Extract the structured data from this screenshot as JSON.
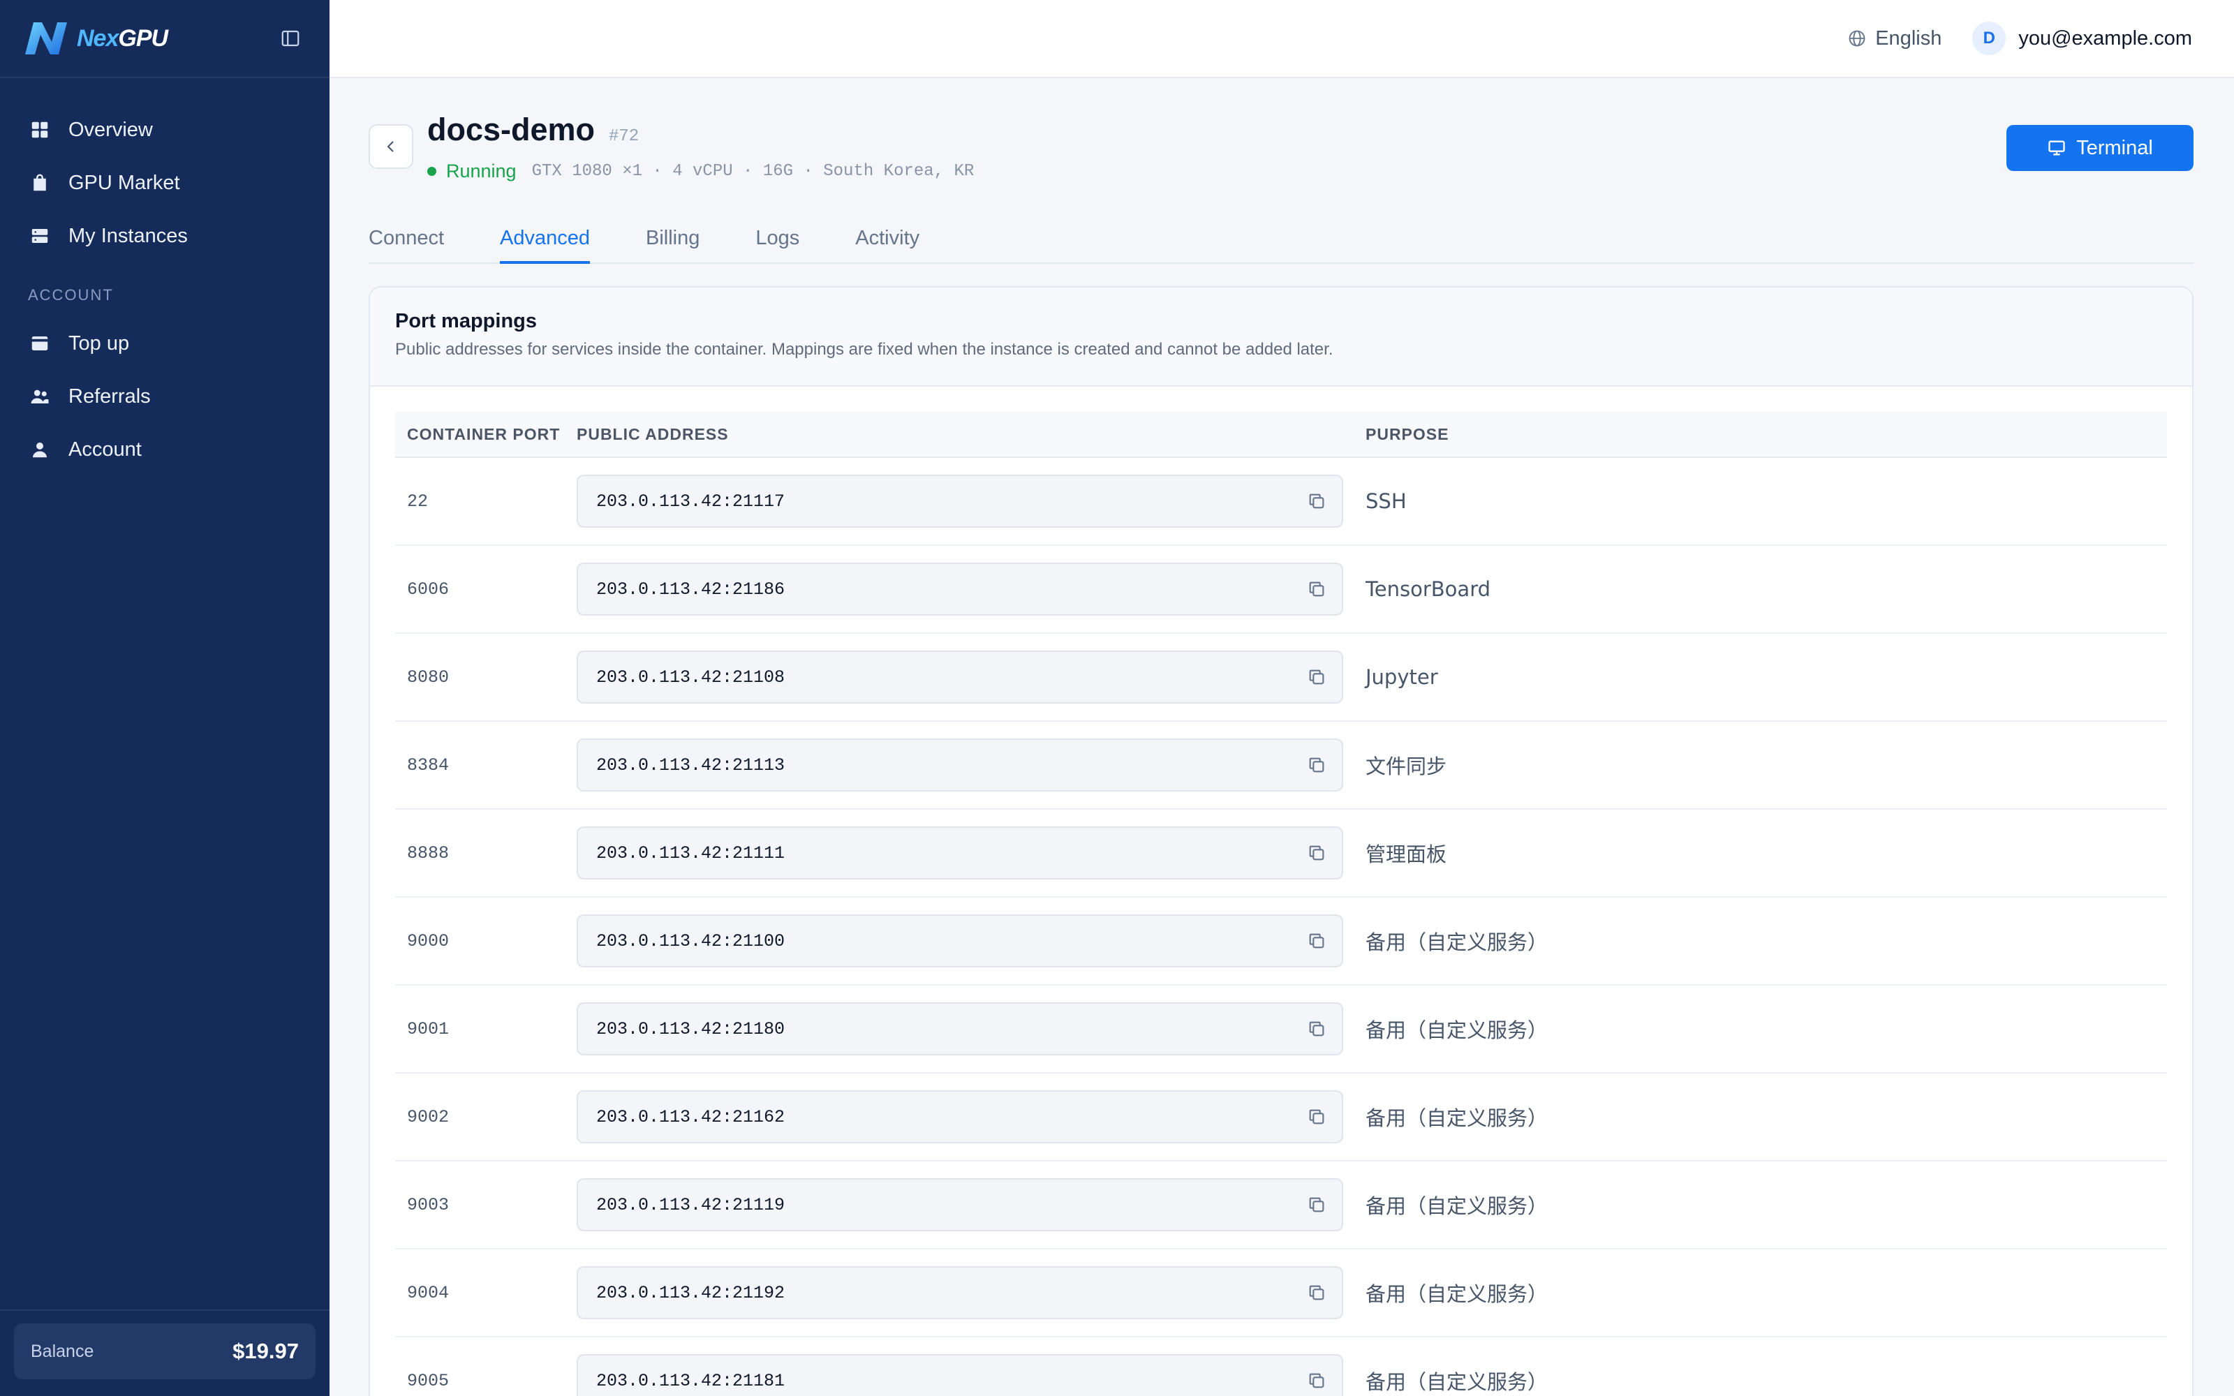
{
  "brand": {
    "name_part1": "Nex",
    "name_part2": "GPU"
  },
  "sidebar": {
    "items": [
      {
        "label": "Overview",
        "icon": "grid-icon"
      },
      {
        "label": "GPU Market",
        "icon": "bag-icon"
      },
      {
        "label": "My Instances",
        "icon": "server-icon"
      }
    ],
    "section_label": "ACCOUNT",
    "account_items": [
      {
        "label": "Top up",
        "icon": "card-icon"
      },
      {
        "label": "Referrals",
        "icon": "users-icon"
      },
      {
        "label": "Account",
        "icon": "user-icon"
      }
    ],
    "balance_label": "Balance",
    "balance_value": "$19.97"
  },
  "topbar": {
    "language": "English",
    "avatar_initial": "D",
    "email": "you@example.com"
  },
  "instance": {
    "name": "docs-demo",
    "id": "#72",
    "status": "Running",
    "specs": "GTX 1080 ×1 · 4 vCPU · 16G · South Korea, KR",
    "terminal_label": "Terminal"
  },
  "tabs": [
    {
      "label": "Connect",
      "active": false
    },
    {
      "label": "Advanced",
      "active": true
    },
    {
      "label": "Billing",
      "active": false
    },
    {
      "label": "Logs",
      "active": false
    },
    {
      "label": "Activity",
      "active": false
    }
  ],
  "ports_card": {
    "title": "Port mappings",
    "subtitle": "Public addresses for services inside the container. Mappings are fixed when the instance is created and cannot be added later.",
    "columns": [
      "CONTAINER PORT",
      "PUBLIC ADDRESS",
      "PURPOSE"
    ],
    "rows": [
      {
        "port": "22",
        "address": "203.0.113.42:21117",
        "purpose": "SSH"
      },
      {
        "port": "6006",
        "address": "203.0.113.42:21186",
        "purpose": "TensorBoard"
      },
      {
        "port": "8080",
        "address": "203.0.113.42:21108",
        "purpose": "Jupyter"
      },
      {
        "port": "8384",
        "address": "203.0.113.42:21113",
        "purpose": "文件同步"
      },
      {
        "port": "8888",
        "address": "203.0.113.42:21111",
        "purpose": "管理面板"
      },
      {
        "port": "9000",
        "address": "203.0.113.42:21100",
        "purpose": "备用（自定义服务）"
      },
      {
        "port": "9001",
        "address": "203.0.113.42:21180",
        "purpose": "备用（自定义服务）"
      },
      {
        "port": "9002",
        "address": "203.0.113.42:21162",
        "purpose": "备用（自定义服务）"
      },
      {
        "port": "9003",
        "address": "203.0.113.42:21119",
        "purpose": "备用（自定义服务）"
      },
      {
        "port": "9004",
        "address": "203.0.113.42:21192",
        "purpose": "备用（自定义服务）"
      },
      {
        "port": "9005",
        "address": "203.0.113.42:21181",
        "purpose": "备用（自定义服务）"
      }
    ]
  },
  "colors": {
    "sidebar_bg": "#152b5a",
    "accent": "#1473f0",
    "running": "#16a34a"
  }
}
